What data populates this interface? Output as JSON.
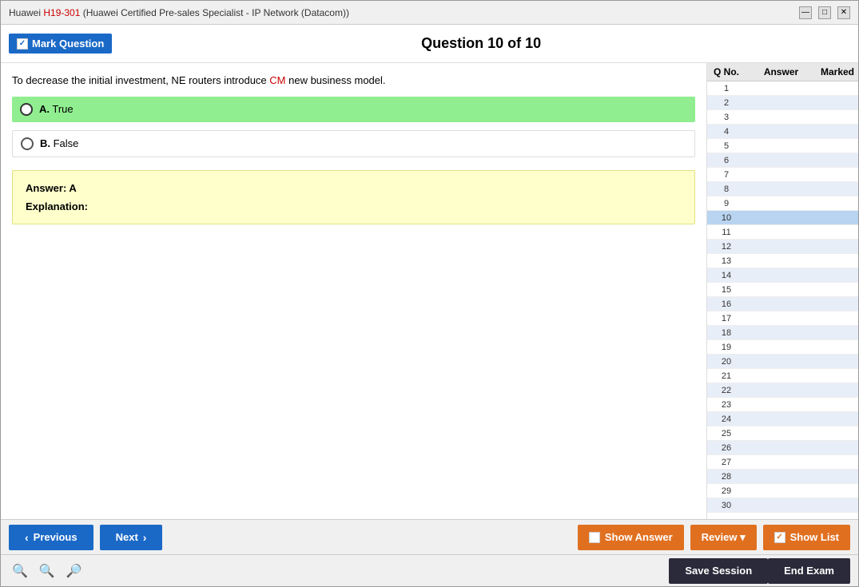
{
  "window": {
    "title": "Huawei H19-301 (Huawei Certified Pre-sales Specialist - IP Network (Datacom))",
    "title_plain": "Huawei ",
    "title_red": "H19-301",
    "title_rest": " (Huawei Certified Pre-sales Specialist - IP Network (Datacom))"
  },
  "toolbar": {
    "mark_label": "Mark Question",
    "question_title": "Question 10 of 10"
  },
  "question": {
    "text_before": "To decrease the initial investment, NE routers introduce ",
    "text_highlight": "CM",
    "text_after": " new business model.",
    "options": [
      {
        "letter": "A",
        "text": "True",
        "selected": true
      },
      {
        "letter": "B",
        "text": "False",
        "selected": false
      }
    ],
    "answer": "Answer: A",
    "explanation_label": "Explanation:"
  },
  "right_panel": {
    "header": {
      "qno": "Q No.",
      "answer": "Answer",
      "marked": "Marked"
    },
    "rows": [
      {
        "num": 1,
        "answer": "",
        "marked": ""
      },
      {
        "num": 2,
        "answer": "",
        "marked": ""
      },
      {
        "num": 3,
        "answer": "",
        "marked": ""
      },
      {
        "num": 4,
        "answer": "",
        "marked": ""
      },
      {
        "num": 5,
        "answer": "",
        "marked": ""
      },
      {
        "num": 6,
        "answer": "",
        "marked": ""
      },
      {
        "num": 7,
        "answer": "",
        "marked": ""
      },
      {
        "num": 8,
        "answer": "",
        "marked": ""
      },
      {
        "num": 9,
        "answer": "",
        "marked": ""
      },
      {
        "num": 10,
        "answer": "",
        "marked": "",
        "active": true
      },
      {
        "num": 11,
        "answer": "",
        "marked": ""
      },
      {
        "num": 12,
        "answer": "",
        "marked": ""
      },
      {
        "num": 13,
        "answer": "",
        "marked": ""
      },
      {
        "num": 14,
        "answer": "",
        "marked": ""
      },
      {
        "num": 15,
        "answer": "",
        "marked": ""
      },
      {
        "num": 16,
        "answer": "",
        "marked": ""
      },
      {
        "num": 17,
        "answer": "",
        "marked": ""
      },
      {
        "num": 18,
        "answer": "",
        "marked": ""
      },
      {
        "num": 19,
        "answer": "",
        "marked": ""
      },
      {
        "num": 20,
        "answer": "",
        "marked": ""
      },
      {
        "num": 21,
        "answer": "",
        "marked": ""
      },
      {
        "num": 22,
        "answer": "",
        "marked": ""
      },
      {
        "num": 23,
        "answer": "",
        "marked": ""
      },
      {
        "num": 24,
        "answer": "",
        "marked": ""
      },
      {
        "num": 25,
        "answer": "",
        "marked": ""
      },
      {
        "num": 26,
        "answer": "",
        "marked": ""
      },
      {
        "num": 27,
        "answer": "",
        "marked": ""
      },
      {
        "num": 28,
        "answer": "",
        "marked": ""
      },
      {
        "num": 29,
        "answer": "",
        "marked": ""
      },
      {
        "num": 30,
        "answer": "",
        "marked": ""
      }
    ]
  },
  "bottom": {
    "previous_label": "Previous",
    "next_label": "Next",
    "show_answer_label": "Show Answer",
    "review_label": "Review",
    "show_list_label": "Show List",
    "save_session_label": "Save Session",
    "end_exam_label": "End Exam"
  },
  "colors": {
    "nav_btn": "#1a69c7",
    "action_btn": "#e07020",
    "dark_btn": "#2a2a3a",
    "mark_btn": "#1a69c7",
    "selected_option": "#90ee90",
    "answer_box": "#ffffcc"
  }
}
